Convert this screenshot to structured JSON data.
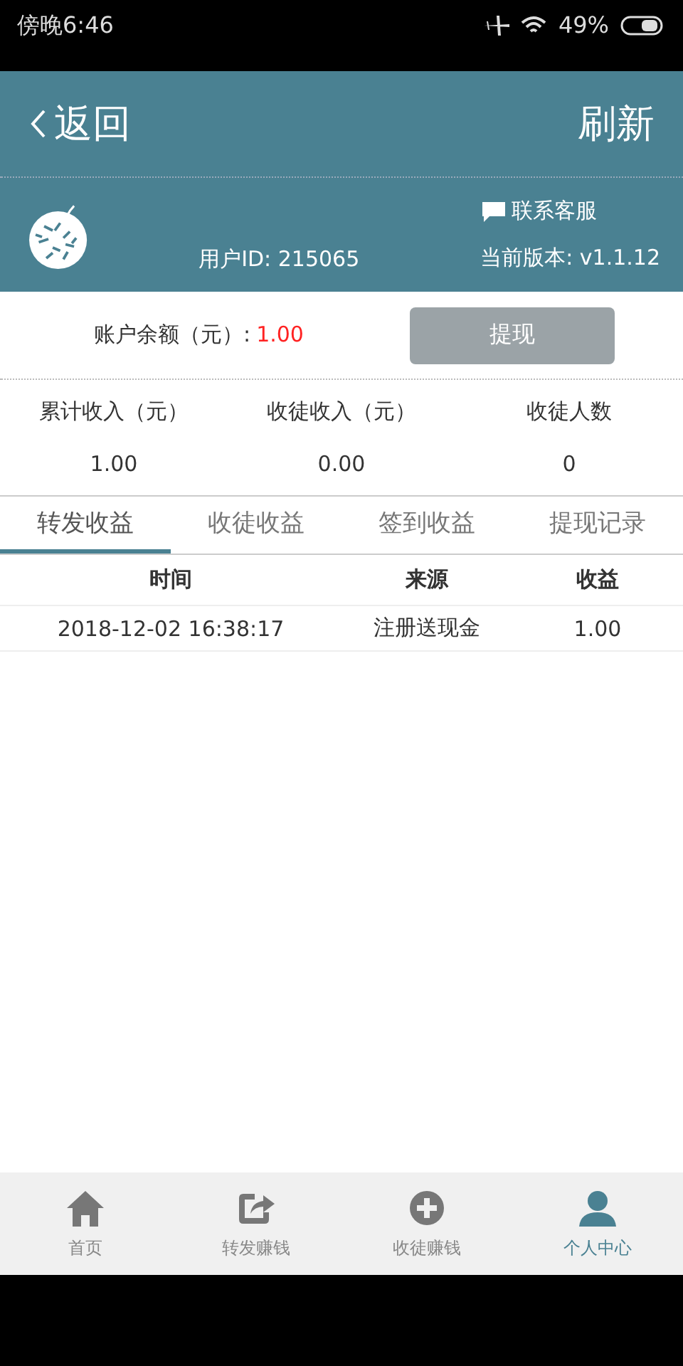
{
  "status_bar": {
    "time": "傍晚6:46",
    "battery": "49%"
  },
  "header": {
    "back": "返回",
    "refresh": "刷新"
  },
  "profile": {
    "contact": "联系客服",
    "user_id": "用户ID: 215065",
    "version": "当前版本: v1.1.12"
  },
  "balance": {
    "label": "账户余额（元）:",
    "amount": "1.00",
    "withdraw": "提现"
  },
  "stats": [
    {
      "label": "累计收入（元）",
      "value": "1.00"
    },
    {
      "label": "收徒收入（元）",
      "value": "0.00"
    },
    {
      "label": "收徒人数",
      "value": "0"
    }
  ],
  "tabs": [
    {
      "label": "转发收益",
      "selected": true
    },
    {
      "label": "收徒收益",
      "selected": false
    },
    {
      "label": "签到收益",
      "selected": false
    },
    {
      "label": "提现记录",
      "selected": false
    }
  ],
  "table": {
    "columns": [
      "时间",
      "来源",
      "收益"
    ],
    "rows": [
      [
        "2018-12-02 16:38:17",
        "注册送现金",
        "1.00"
      ]
    ]
  },
  "bottom_nav": [
    {
      "label": "首页",
      "kind": "home",
      "selected": false
    },
    {
      "label": "转发赚钱",
      "kind": "share",
      "selected": false
    },
    {
      "label": "收徒赚钱",
      "kind": "add",
      "selected": false
    },
    {
      "label": "个人中心",
      "kind": "person",
      "selected": true
    }
  ]
}
